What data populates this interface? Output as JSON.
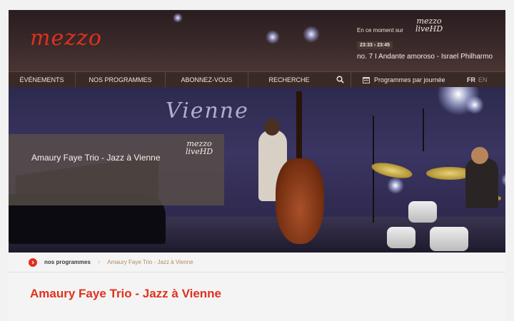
{
  "header": {
    "logo": "mezzo",
    "now_label": "En ce moment sur",
    "live_logo_line1": "mezzo",
    "live_logo_line2": "liveHD",
    "time_range": "23:33 › 23:45",
    "now_title": "no. 7 I Andante amoroso - Israel Philharmo"
  },
  "nav": {
    "items": [
      {
        "label": "ÉVÉNEMENTS"
      },
      {
        "label": "NOS PROGRAMMES"
      },
      {
        "label": "ABONNEZ-VOUS"
      },
      {
        "label": "RECHERCHE"
      }
    ],
    "schedule_label": "Programmes par journée",
    "lang_fr": "FR",
    "lang_en": "EN"
  },
  "hero": {
    "caption": "Amaury Faye Trio - Jazz à Vienne",
    "logo_line1": "mezzo",
    "logo_line2": "liveHD",
    "stage_sign": "Vienne"
  },
  "breadcrumb": {
    "home": "nos programmes",
    "separator": "›",
    "current": "Amaury Faye Trio - Jazz à Vienne"
  },
  "page_title": "Amaury Faye Trio - Jazz à Vienne",
  "colors": {
    "accent": "#e0301e",
    "nav_bg": "#3a2a26"
  }
}
